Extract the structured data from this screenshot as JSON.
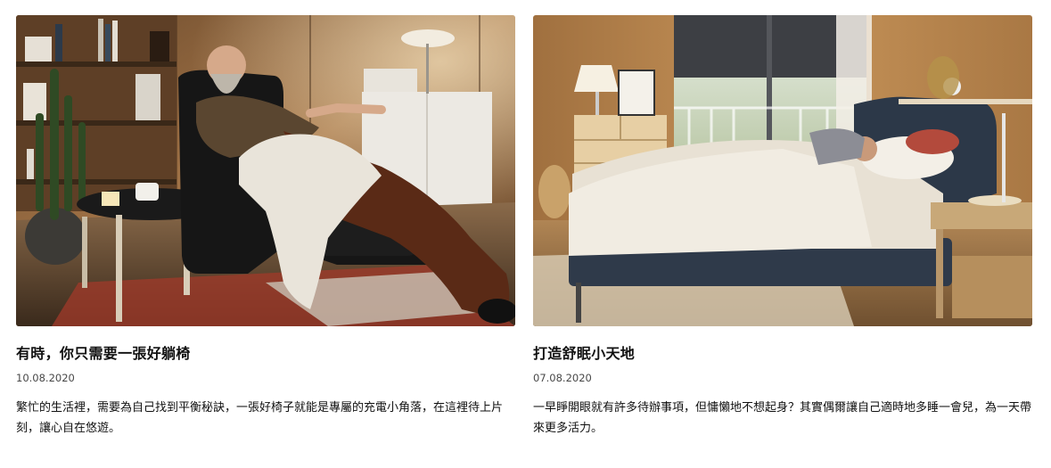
{
  "articles": [
    {
      "title": "有時，你只需要一張好躺椅",
      "date": "10.08.2020",
      "description": "繁忙的生活裡，需要為自己找到平衡秘訣，一張好椅子就能是專屬的充電小角落，在這裡待上片刻，讓心自在悠遊。",
      "image_subject": "man-relaxing-in-recliner-photo"
    },
    {
      "title": "打造舒眠小天地",
      "date": "07.08.2020",
      "description": "一早睜開眼就有許多待辦事項，但慵懶地不想起身？其實偶爾讓自己適時地多睡一會兒，為一天帶來更多活力。",
      "image_subject": "woman-sleeping-in-bed-photo"
    }
  ],
  "colors": {
    "text": "#111111",
    "date": "#484848",
    "background": "#ffffff"
  }
}
